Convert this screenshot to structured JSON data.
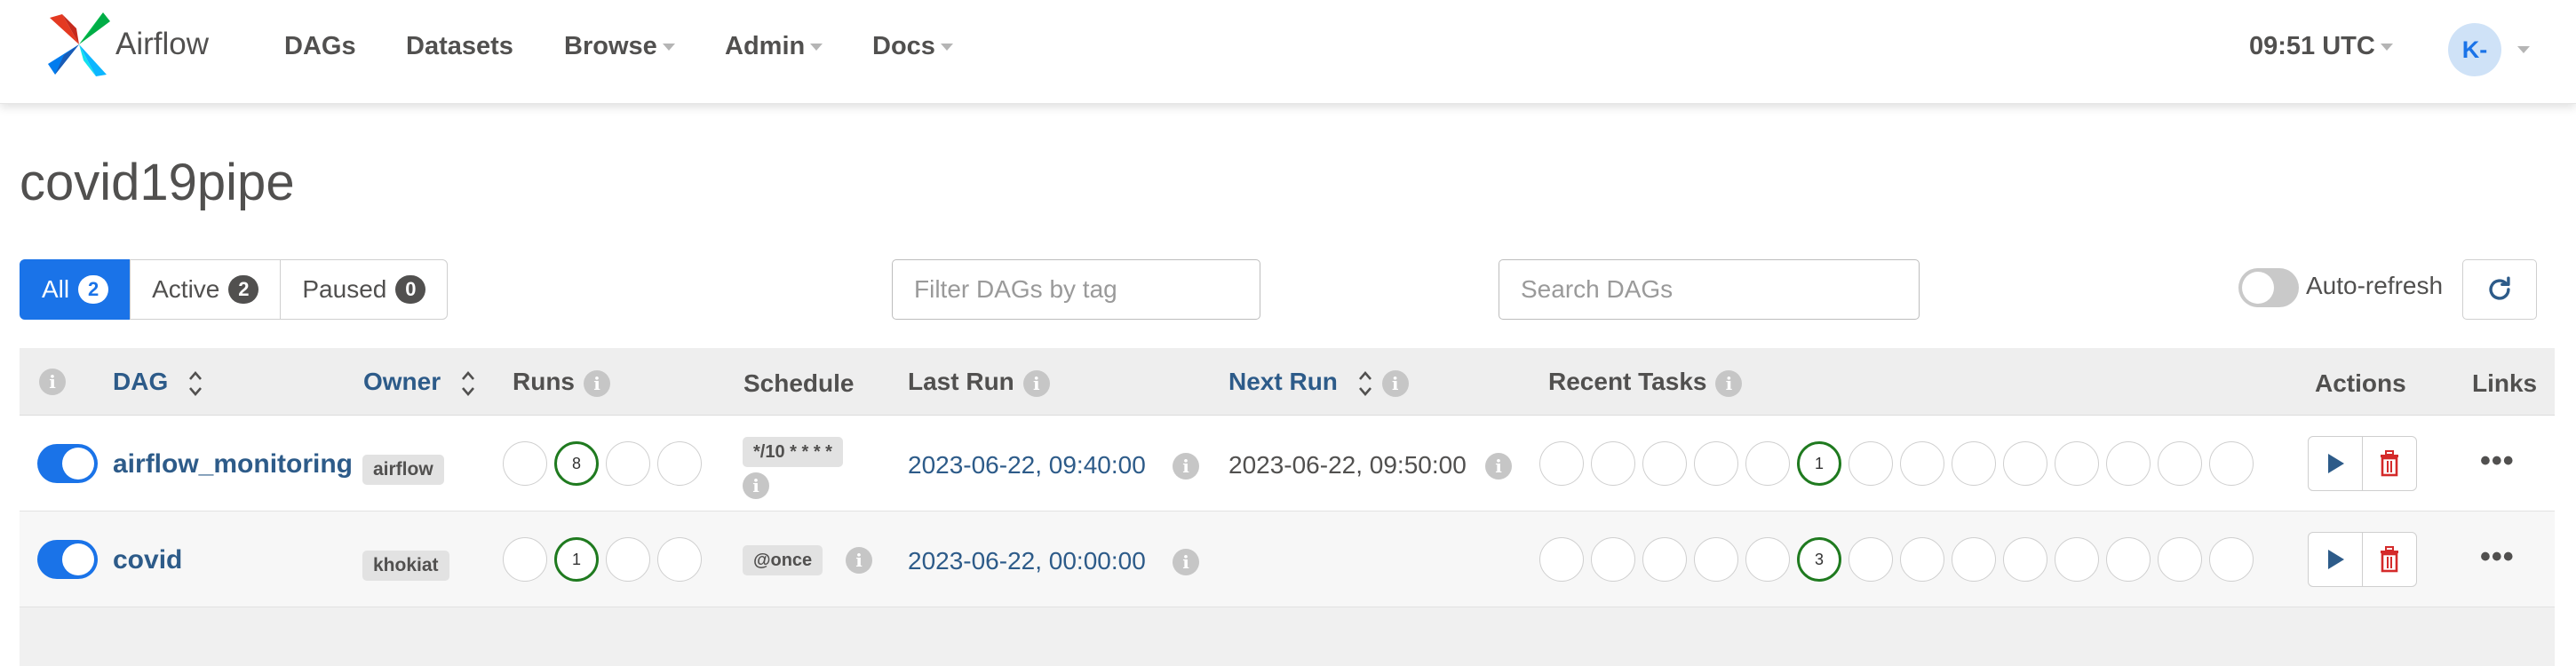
{
  "navbar": {
    "brand": "Airflow",
    "items": [
      "DAGs",
      "Datasets",
      "Browse",
      "Admin",
      "Docs"
    ],
    "time": "09:51 UTC",
    "avatar_initials": "K-"
  },
  "page": {
    "title": "covid19pipe"
  },
  "filters": {
    "all_label": "All",
    "all_count": "2",
    "active_label": "Active",
    "active_count": "2",
    "paused_label": "Paused",
    "paused_count": "0",
    "tag_placeholder": "Filter DAGs by tag",
    "search_placeholder": "Search DAGs",
    "autorefresh_label": "Auto-refresh"
  },
  "table": {
    "headers": {
      "dag": "DAG",
      "owner": "Owner",
      "runs": "Runs",
      "schedule": "Schedule",
      "last_run": "Last Run",
      "next_run": "Next Run",
      "recent_tasks": "Recent Tasks",
      "actions": "Actions",
      "links": "Links"
    },
    "rows": [
      {
        "dag": "airflow_monitoring",
        "owner": "airflow",
        "runs_success_count": "8",
        "schedule": "*/10 * * * *",
        "last_run": "2023-06-22, 09:40:00",
        "next_run": "2023-06-22, 09:50:00",
        "tasks_success_count": "1"
      },
      {
        "dag": "covid",
        "owner": "khokiat",
        "runs_success_count": "1",
        "schedule": "@once",
        "last_run": "2023-06-22, 00:00:00",
        "next_run": "",
        "tasks_success_count": "3"
      }
    ],
    "links_glyph": "•••",
    "info_glyph": "i"
  },
  "colors": {
    "accent": "#1a73e8",
    "link": "#2d5b89",
    "success": "#1f7a1f",
    "delete": "#d42a2a",
    "text": "#51504f"
  }
}
